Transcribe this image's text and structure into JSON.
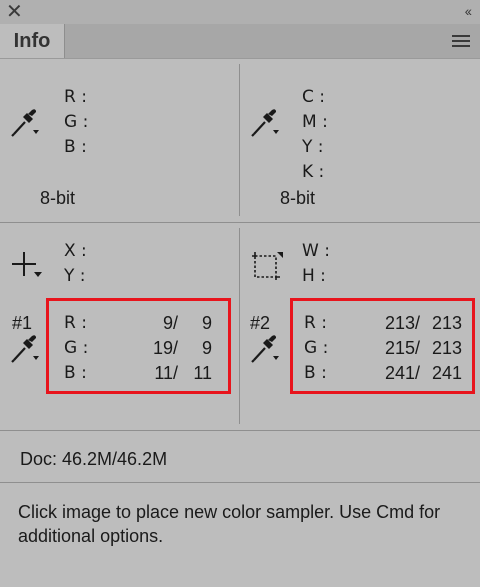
{
  "panel": {
    "tab_label": "Info",
    "close_icon": "close-icon",
    "collapse_icon": "double-chevron-left-icon",
    "menu_icon": "hamburger-menu-icon"
  },
  "rgb_readout": {
    "labels": [
      "R :",
      "G :",
      "B :"
    ],
    "bit_depth": "8-bit",
    "icon": "eyedropper-icon"
  },
  "cmyk_readout": {
    "labels": [
      "C :",
      "M :",
      "Y :",
      "K :"
    ],
    "bit_depth": "8-bit",
    "icon": "eyedropper-icon"
  },
  "position_readout": {
    "labels": [
      "X :",
      "Y :"
    ],
    "icon": "crosshair-icon"
  },
  "size_readout": {
    "labels": [
      "W :",
      "H :"
    ],
    "icon": "selection-size-icon"
  },
  "sampler1": {
    "id": "#1",
    "rows": [
      {
        "label": "R :",
        "before": "9/",
        "after": "9"
      },
      {
        "label": "G :",
        "before": "19/",
        "after": "9"
      },
      {
        "label": "B :",
        "before": "11/",
        "after": "11"
      }
    ]
  },
  "sampler2": {
    "id": "#2",
    "rows": [
      {
        "label": "R :",
        "before": "213/",
        "after": "213"
      },
      {
        "label": "G :",
        "before": "215/",
        "after": "213"
      },
      {
        "label": "B :",
        "before": "241/",
        "after": "241"
      }
    ]
  },
  "doc_info": "Doc: 46.2M/46.2M",
  "hint_text": "Click image to place new color sampler.  Use Cmd for additional options.",
  "colors": {
    "highlight_box": "#e8141c",
    "panel_bg": "#bdbdbd"
  }
}
